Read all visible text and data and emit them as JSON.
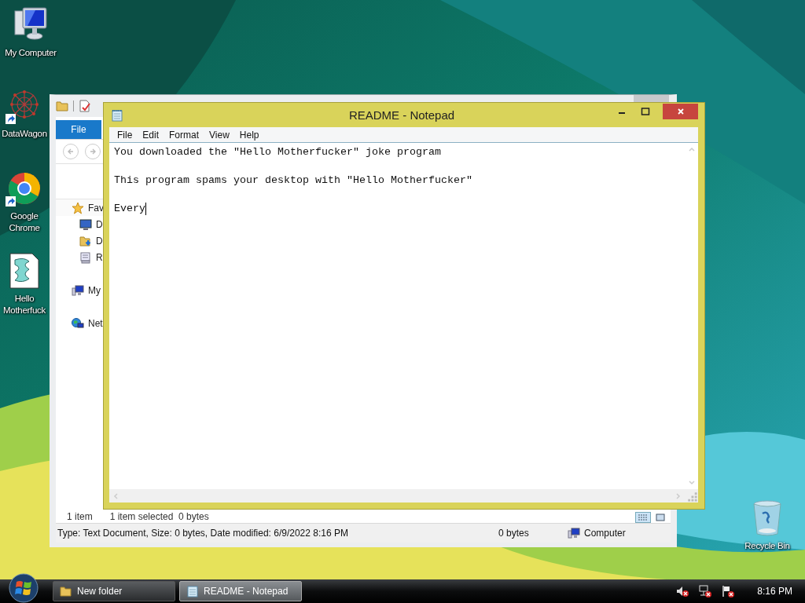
{
  "desktop": {
    "icons": [
      {
        "label": "My Computer",
        "kind": "computer",
        "shortcut": false
      },
      {
        "label": "DataWagon",
        "kind": "network-app",
        "shortcut": true
      },
      {
        "label": "Google Chrome",
        "kind": "browser",
        "shortcut": true
      },
      {
        "label": "Hello Motherfuck",
        "kind": "script",
        "shortcut": false
      }
    ],
    "recycle_bin": {
      "label": "Recycle Bin"
    }
  },
  "explorer": {
    "ribbon_tab": "File",
    "nav_pane": [
      {
        "label": "Fav",
        "kind": "star",
        "children": [
          {
            "label": "D",
            "kind": "desktop"
          },
          {
            "label": "D",
            "kind": "download"
          },
          {
            "label": "R",
            "kind": "recent"
          }
        ]
      },
      {
        "label": "My",
        "kind": "computer"
      },
      {
        "label": "Net",
        "kind": "network"
      }
    ],
    "status_bar": {
      "count": "1 item",
      "selection": "1 item selected  0 bytes"
    },
    "details_bar": {
      "info": "Type: Text Document, Size: 0 bytes, Date modified: 6/9/2022 8:16 PM",
      "size": "0 bytes",
      "location": "Computer"
    }
  },
  "notepad": {
    "title": "README - Notepad",
    "menu": [
      "File",
      "Edit",
      "Format",
      "View",
      "Help"
    ],
    "text": "You downloaded the \"Hello Motherfucker\" joke program\n\nThis program spams your desktop with \"Hello Motherfucker\"\n\nEvery"
  },
  "taskbar": {
    "buttons": [
      {
        "label": "New folder",
        "kind": "folder",
        "selected": false
      },
      {
        "label": "README - Notepad",
        "kind": "notepad",
        "selected": true
      }
    ],
    "clock": "8:16 PM"
  }
}
